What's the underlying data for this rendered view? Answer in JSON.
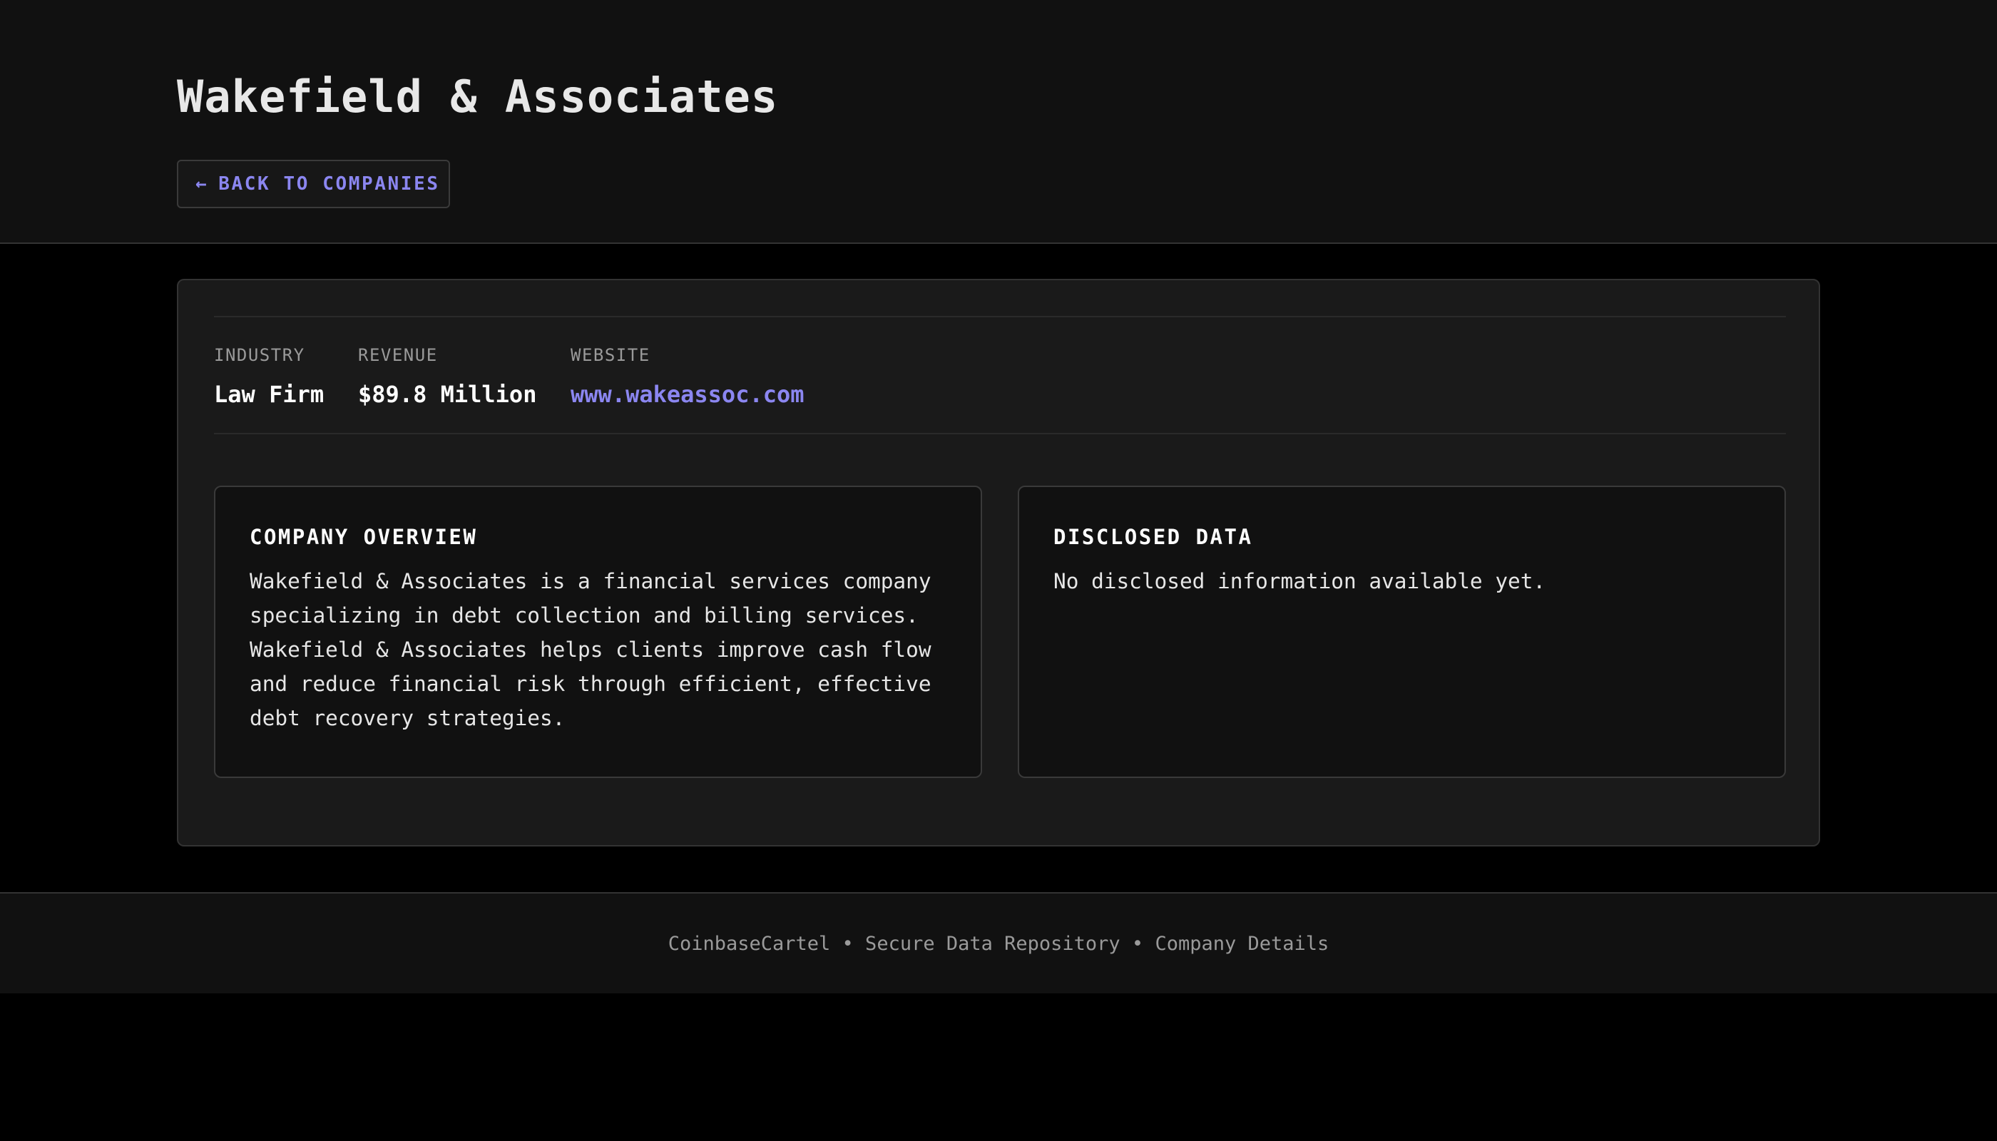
{
  "header": {
    "title": "Wakefield & Associates",
    "back_arrow": "←",
    "back_label": "BACK TO COMPANIES"
  },
  "company": {
    "meta": [
      {
        "label": "INDUSTRY",
        "value": "Law Firm"
      },
      {
        "label": "REVENUE",
        "value": "$89.8 Million"
      },
      {
        "label": "WEBSITE",
        "value": "www.wakeassoc.com"
      }
    ],
    "overview": {
      "title": "COMPANY OVERVIEW",
      "text": "Wakefield & Associates is a financial services company specializing in debt collection and billing services. Wakefield & Associates helps clients improve cash flow and reduce financial risk through efficient, effective debt recovery strategies."
    },
    "disclosed": {
      "title": "DISCLOSED DATA",
      "text": "No disclosed information available yet."
    }
  },
  "footer": {
    "text": "CoinbaseCartel • Secure Data Repository • Company Details"
  },
  "colors": {
    "accent": "#8b86f0",
    "page_background": "#000000",
    "header_background": "#111111",
    "card_background": "#1a1a1a",
    "border": "#333333",
    "muted_text": "#9a9a9a"
  }
}
